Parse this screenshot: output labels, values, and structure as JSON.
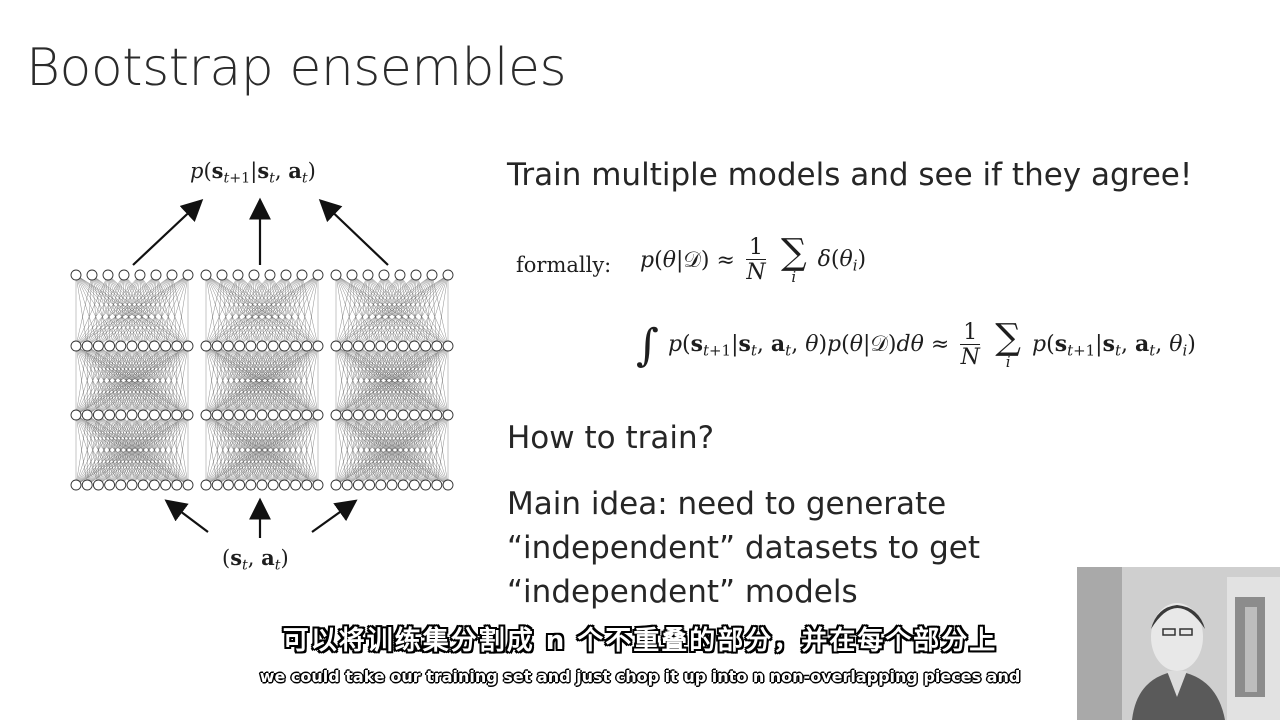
{
  "slide": {
    "title": "Bootstrap ensembles",
    "heading": "Train multiple models and see if they agree!",
    "formally_label": "formally:",
    "how_to_train": "How to train?",
    "main_idea": [
      "Main idea: need to generate",
      "“independent” datasets to get",
      "“independent” models"
    ]
  },
  "diagram": {
    "output_label": "p(s_{t+1}|s_t, a_t)",
    "input_label": "(s_t, a_t)"
  },
  "subtitles": {
    "chinese": "可以将训练集分割成 n 个不重叠的部分，并在每个部分上",
    "english": "we could take our training set and just chop it up into n non-overlapping pieces and"
  },
  "colors": {
    "text": "#262626",
    "subtitle_outline": "#000000",
    "subtitle_fill": "#ffffff"
  }
}
